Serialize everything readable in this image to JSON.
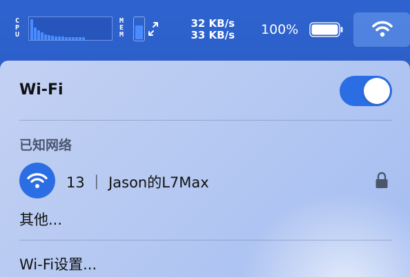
{
  "menubar": {
    "cpu_label": [
      "C",
      "P",
      "U"
    ],
    "cpu_history": [
      0.92,
      0.55,
      0.42,
      0.33,
      0.25,
      0.2,
      0.18,
      0.16,
      0.15,
      0.14,
      0.13,
      0.12,
      0.12,
      0.12,
      0.11,
      0.11
    ],
    "mem_label": [
      "M",
      "E",
      "M"
    ],
    "mem_fraction": 0.72,
    "net_upload": "32 KB/s",
    "net_download": "33 KB/s",
    "battery_percent": "100%",
    "battery_level": 1.0,
    "wifi_icon": "wifi-icon",
    "expand_icon": "expand-icon"
  },
  "wifi_menu": {
    "title": "Wi-Fi",
    "toggle_on": true,
    "known_networks_label": "已知网络",
    "networks": [
      {
        "name": "13 ｜ Jason的L7Max",
        "icon": "wifi-icon",
        "secured": true
      }
    ],
    "other_label": "其他...",
    "settings_label": "Wi-Fi设置..."
  },
  "colors": {
    "accent": "#2b6ee4",
    "menubar_bg": "#2e63cf"
  }
}
